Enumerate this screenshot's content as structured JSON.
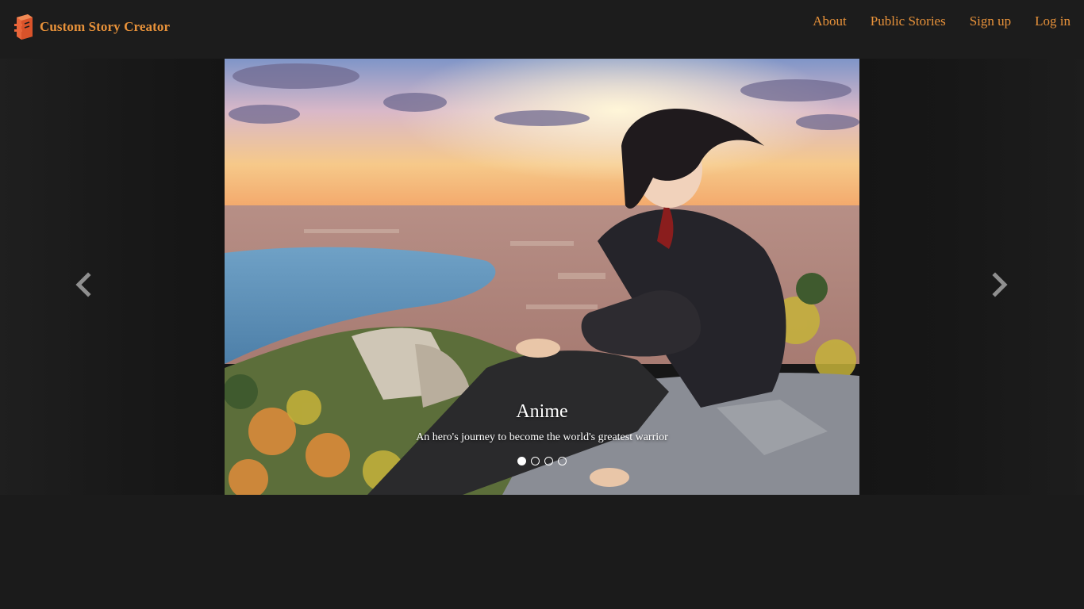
{
  "navbar": {
    "brand": "Custom Story Creator",
    "brand_icon": "book-logo-icon",
    "links": [
      "About",
      "Public Stories",
      "Sign up",
      "Log in"
    ],
    "accent_color": "#e8923a"
  },
  "carousel": {
    "active_index": 0,
    "slide_count": 4,
    "slide": {
      "title": "Anime",
      "description": "An hero's journey to become the world's greatest warrior"
    },
    "prev_icon": "chevron-left-icon",
    "next_icon": "chevron-right-icon"
  }
}
